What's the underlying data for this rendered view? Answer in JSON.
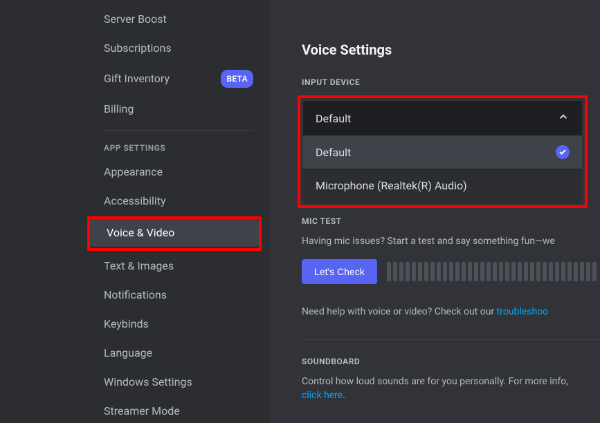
{
  "sidebar": {
    "items_top": [
      {
        "label": "Server Boost"
      },
      {
        "label": "Subscriptions"
      },
      {
        "label": "Gift Inventory",
        "badge": "BETA"
      },
      {
        "label": "Billing"
      }
    ],
    "section_header": "APP SETTINGS",
    "items_app": [
      {
        "label": "Appearance"
      },
      {
        "label": "Accessibility"
      },
      {
        "label": "Voice & Video",
        "active": true
      },
      {
        "label": "Text & Images"
      },
      {
        "label": "Notifications"
      },
      {
        "label": "Keybinds"
      },
      {
        "label": "Language"
      },
      {
        "label": "Windows Settings"
      },
      {
        "label": "Streamer Mode"
      }
    ]
  },
  "main": {
    "title": "Voice Settings",
    "input_device_label": "INPUT DEVICE",
    "dropdown": {
      "selected": "Default",
      "options": [
        {
          "label": "Default",
          "checked": true
        },
        {
          "label": "Microphone (Realtek(R) Audio)",
          "checked": false
        }
      ]
    },
    "mic_test_label": "MIC TEST",
    "mic_test_help": "Having mic issues? Start a test and say something fun—we",
    "lets_check": "Let's Check",
    "help_prefix": "Need help with voice or video? Check out our ",
    "help_link": "troubleshoo",
    "soundboard_label": "SOUNDBOARD",
    "soundboard_text_prefix": "Control how loud sounds are for you personally. For more info, ",
    "soundboard_link": "click here",
    "soundboard_text_suffix": "."
  }
}
